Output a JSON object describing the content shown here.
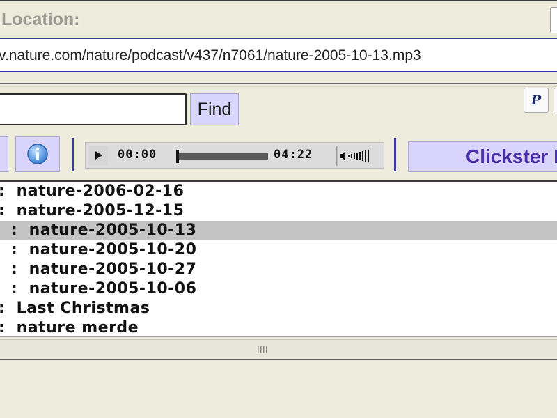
{
  "location": {
    "label": "Location:",
    "url": "v.nature.com/nature/podcast/v437/n7061/nature-2005-10-13.mp3"
  },
  "search": {
    "value": "",
    "find_label": "Find"
  },
  "toolbar": {
    "info_icon": "info-icon",
    "paypal_icon": "paypal-icon",
    "clickster_label": "Clickster I"
  },
  "player": {
    "current_time": "00:00",
    "duration": "04:22",
    "progress": 0.0,
    "play_icon": "play-icon",
    "volume_icon": "volume-icon"
  },
  "playlist": {
    "items": [
      {
        "text": ":  nature-2006-02-16",
        "selected": false
      },
      {
        "text": ":  nature-2005-12-15",
        "selected": false
      },
      {
        "text": ":  nature-2005-10-13",
        "selected": true
      },
      {
        "text": ":  nature-2005-10-20",
        "selected": false
      },
      {
        "text": ":  nature-2005-10-27",
        "selected": false
      },
      {
        "text": ":  nature-2005-10-06",
        "selected": false
      },
      {
        "text": ":  Last Christmas",
        "selected": false
      },
      {
        "text": ":  nature merde",
        "selected": false
      }
    ]
  },
  "colors": {
    "button_bg": "#d9d4fb",
    "accent": "#4a2fa9",
    "selected_row": "#c4c4c4"
  }
}
